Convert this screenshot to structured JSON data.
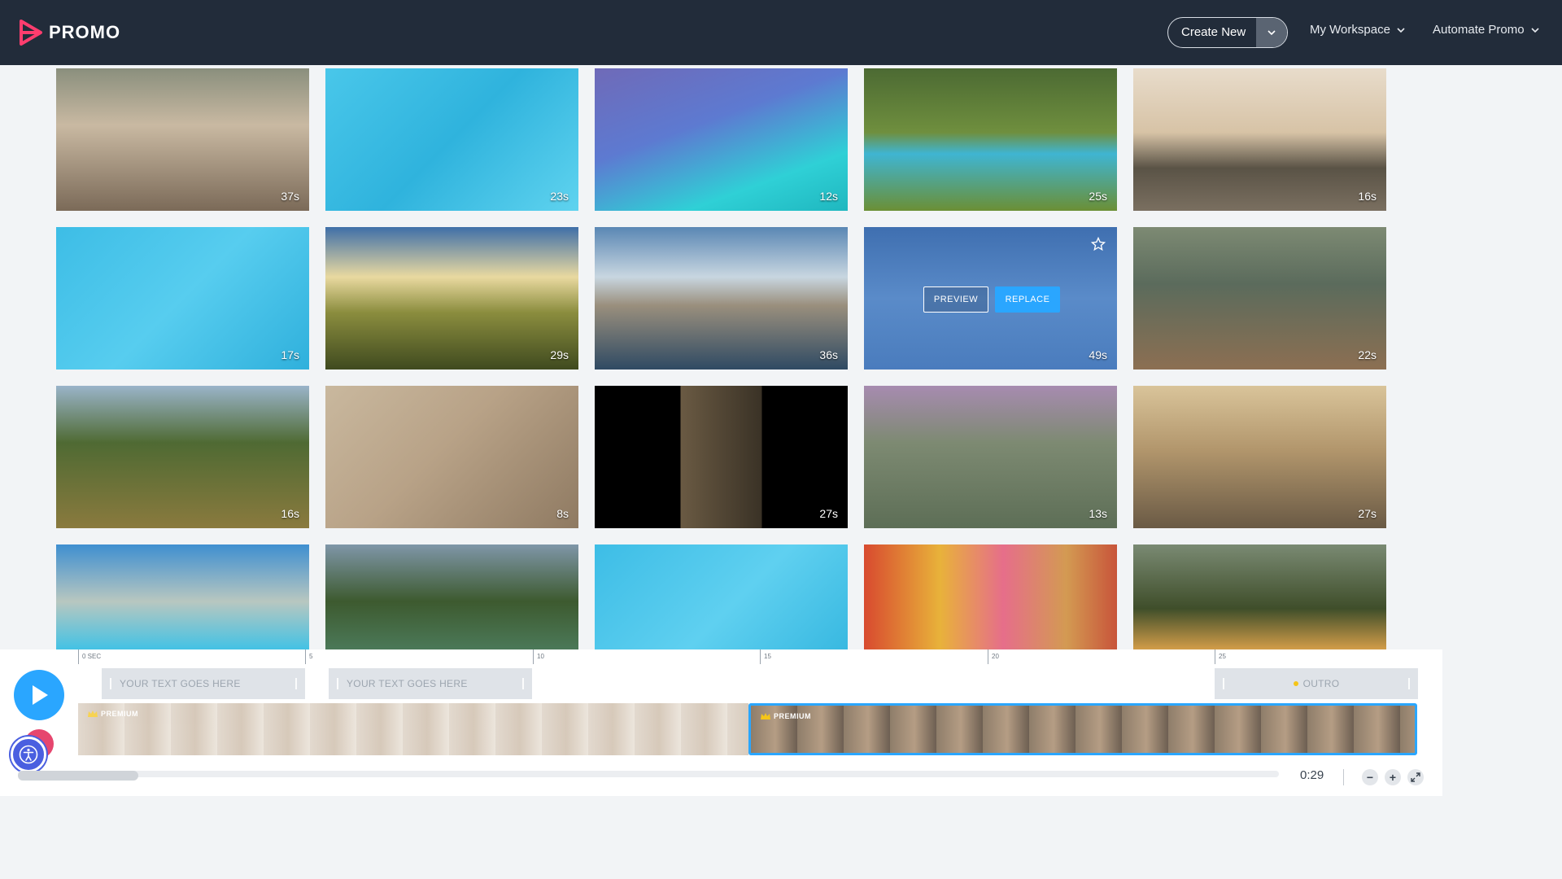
{
  "brand": {
    "name": "PROMO",
    "accent": "#ff3d6e"
  },
  "header": {
    "create_new": "Create New",
    "workspace": "My Workspace",
    "automate": "Automate Promo"
  },
  "tiles": [
    {
      "duration": "37s"
    },
    {
      "duration": "23s"
    },
    {
      "duration": "12s"
    },
    {
      "duration": "25s"
    },
    {
      "duration": "16s"
    },
    {
      "duration": "17s"
    },
    {
      "duration": "29s"
    },
    {
      "duration": "36s"
    },
    {
      "duration": "49s"
    },
    {
      "duration": "22s"
    },
    {
      "duration": "16s"
    },
    {
      "duration": "8s"
    },
    {
      "duration": "27s"
    },
    {
      "duration": "13s"
    },
    {
      "duration": "27s"
    },
    {
      "duration": ""
    },
    {
      "duration": ""
    },
    {
      "duration": ""
    },
    {
      "duration": ""
    },
    {
      "duration": ""
    }
  ],
  "hover": {
    "preview": "PREVIEW",
    "replace": "REPLACE"
  },
  "timeline": {
    "ticks": [
      "0 SEC",
      "5",
      "10",
      "15",
      "20",
      "25"
    ],
    "text_track_1": "YOUR TEXT GOES HERE",
    "text_track_2": "YOUR TEXT GOES HERE",
    "outro": "OUTRO",
    "premium": "PREMIUM",
    "premium_2": "PREMIUM",
    "time": "0:29",
    "zoom_out": "−",
    "zoom_in": "+"
  }
}
